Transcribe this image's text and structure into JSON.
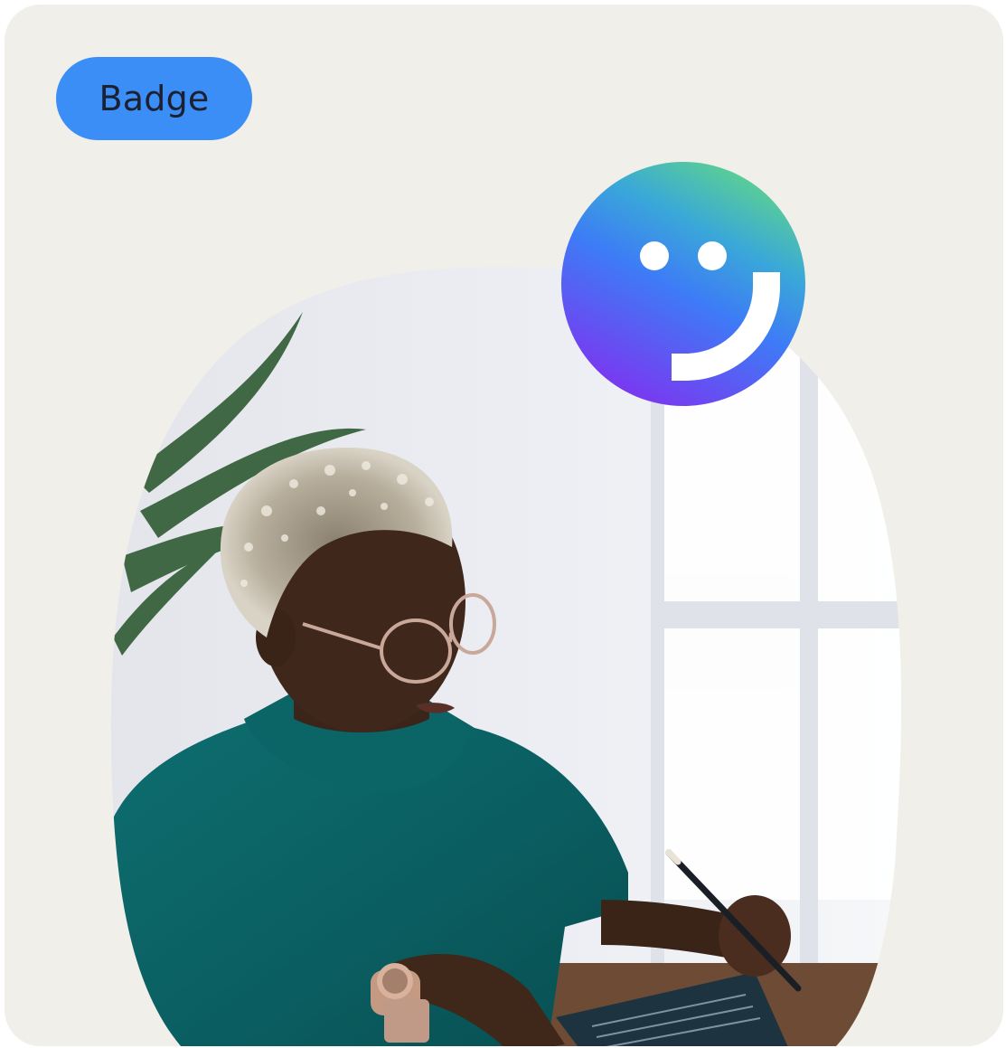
{
  "badge": {
    "label": "Badge"
  },
  "photo": {
    "subject": "woman-writing-at-desk"
  },
  "logo": {
    "icon": "smiley-logo-icon",
    "gradient": [
      "#60d58a",
      "#3d7cf6",
      "#7a38f0"
    ]
  },
  "colors": {
    "card_background": "#f0efea",
    "badge_background": "#3b8ef5",
    "badge_text": "#1c2030"
  }
}
